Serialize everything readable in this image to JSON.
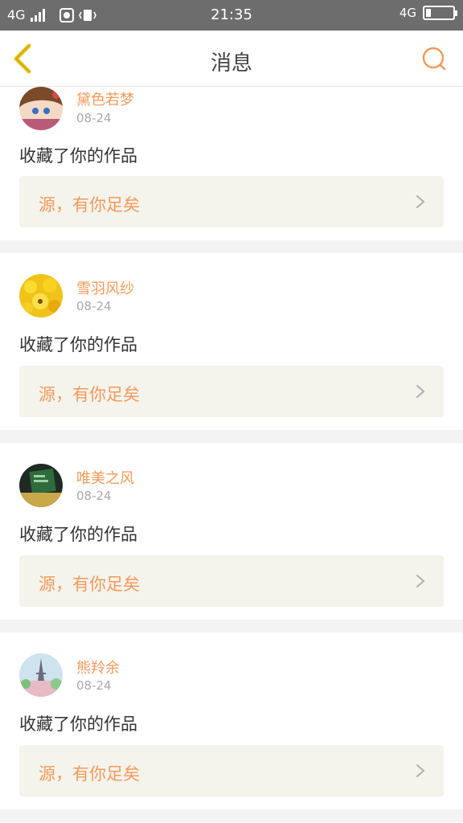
{
  "status_bar": {
    "network_left": "4G",
    "time": "21:35",
    "network_right": "4G"
  },
  "header": {
    "title": "消息",
    "back_icon": "chevron-left-icon",
    "search_icon": "search-icon"
  },
  "colors": {
    "accent": "#f39a5c",
    "back_arrow": "#e8c51b",
    "card_bg": "#f4f3ec",
    "separator": "#f3f3f3"
  },
  "messages": [
    {
      "user": "黛色若梦",
      "date": "08-24",
      "action": "收藏了你的作品",
      "work_title": "源，有你足矣"
    },
    {
      "user": "雪羽风纱",
      "date": "08-24",
      "action": "收藏了你的作品",
      "work_title": "源，有你足矣"
    },
    {
      "user": "唯美之风",
      "date": "08-24",
      "action": "收藏了你的作品",
      "work_title": "源，有你足矣"
    },
    {
      "user": "熊羚余",
      "date": "08-24",
      "action": "收藏了你的作品",
      "work_title": "源，有你足矣"
    }
  ]
}
